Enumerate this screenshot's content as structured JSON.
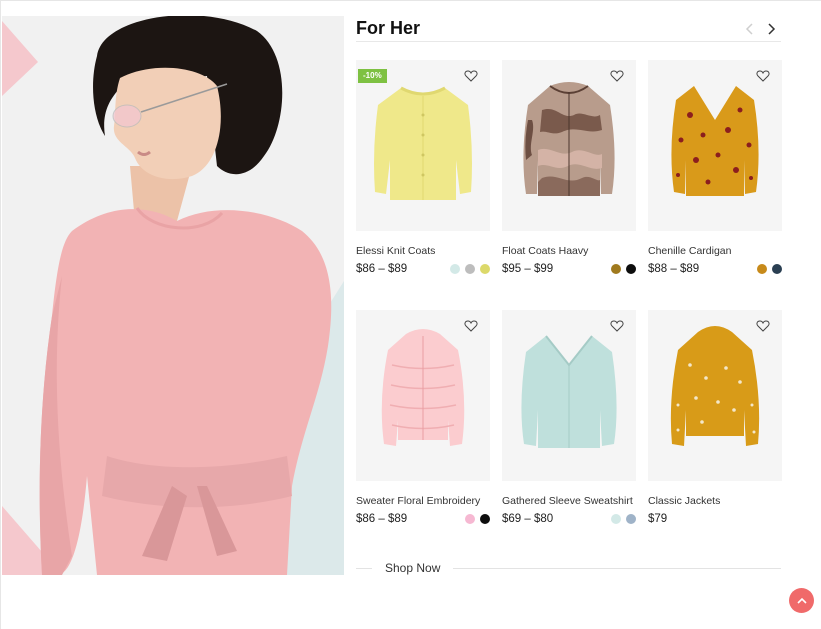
{
  "section": {
    "title": "For Her"
  },
  "nav": {
    "prev_icon": "chevron-left-icon",
    "next_icon": "chevron-right-icon"
  },
  "hero": {
    "image": "woman-pink-sweater-photo"
  },
  "products": [
    {
      "name": "Elessi Knit Coats",
      "price": "$86 – $89",
      "badge": "-10%",
      "swatches": [
        "#d3e9e7",
        "#bdbdbd",
        "#dcd96a"
      ],
      "image": "yellow-cardigan"
    },
    {
      "name": "Float Coats Haavy",
      "price": "$95 – $99",
      "badge": "",
      "swatches": [
        "#a07a1e",
        "#0d0d0d"
      ],
      "image": "camo-jacket"
    },
    {
      "name": "Chenille Cardigan",
      "price": "$88 – $89",
      "badge": "",
      "swatches": [
        "#c78a1a",
        "#2a3f52"
      ],
      "image": "floral-blouse"
    },
    {
      "name": "Sweater Floral Embroidery",
      "price": "$86 – $89",
      "badge": "",
      "swatches": [
        "#f6b8d2",
        "#0d0d0d"
      ],
      "image": "pink-puffer"
    },
    {
      "name": "Gathered Sleeve Sweatshirt",
      "price": "$69 – $80",
      "badge": "",
      "swatches": [
        "#d3e9e7",
        "#9fb3c8"
      ],
      "image": "mint-blouse"
    },
    {
      "name": "Classic Jackets",
      "price": "$79",
      "badge": "",
      "swatches": [],
      "image": "mustard-hoodie"
    }
  ],
  "shop_now": {
    "label": "Shop Now"
  },
  "colors": {
    "accent": "#f06a6a",
    "badge": "#7ec142"
  }
}
